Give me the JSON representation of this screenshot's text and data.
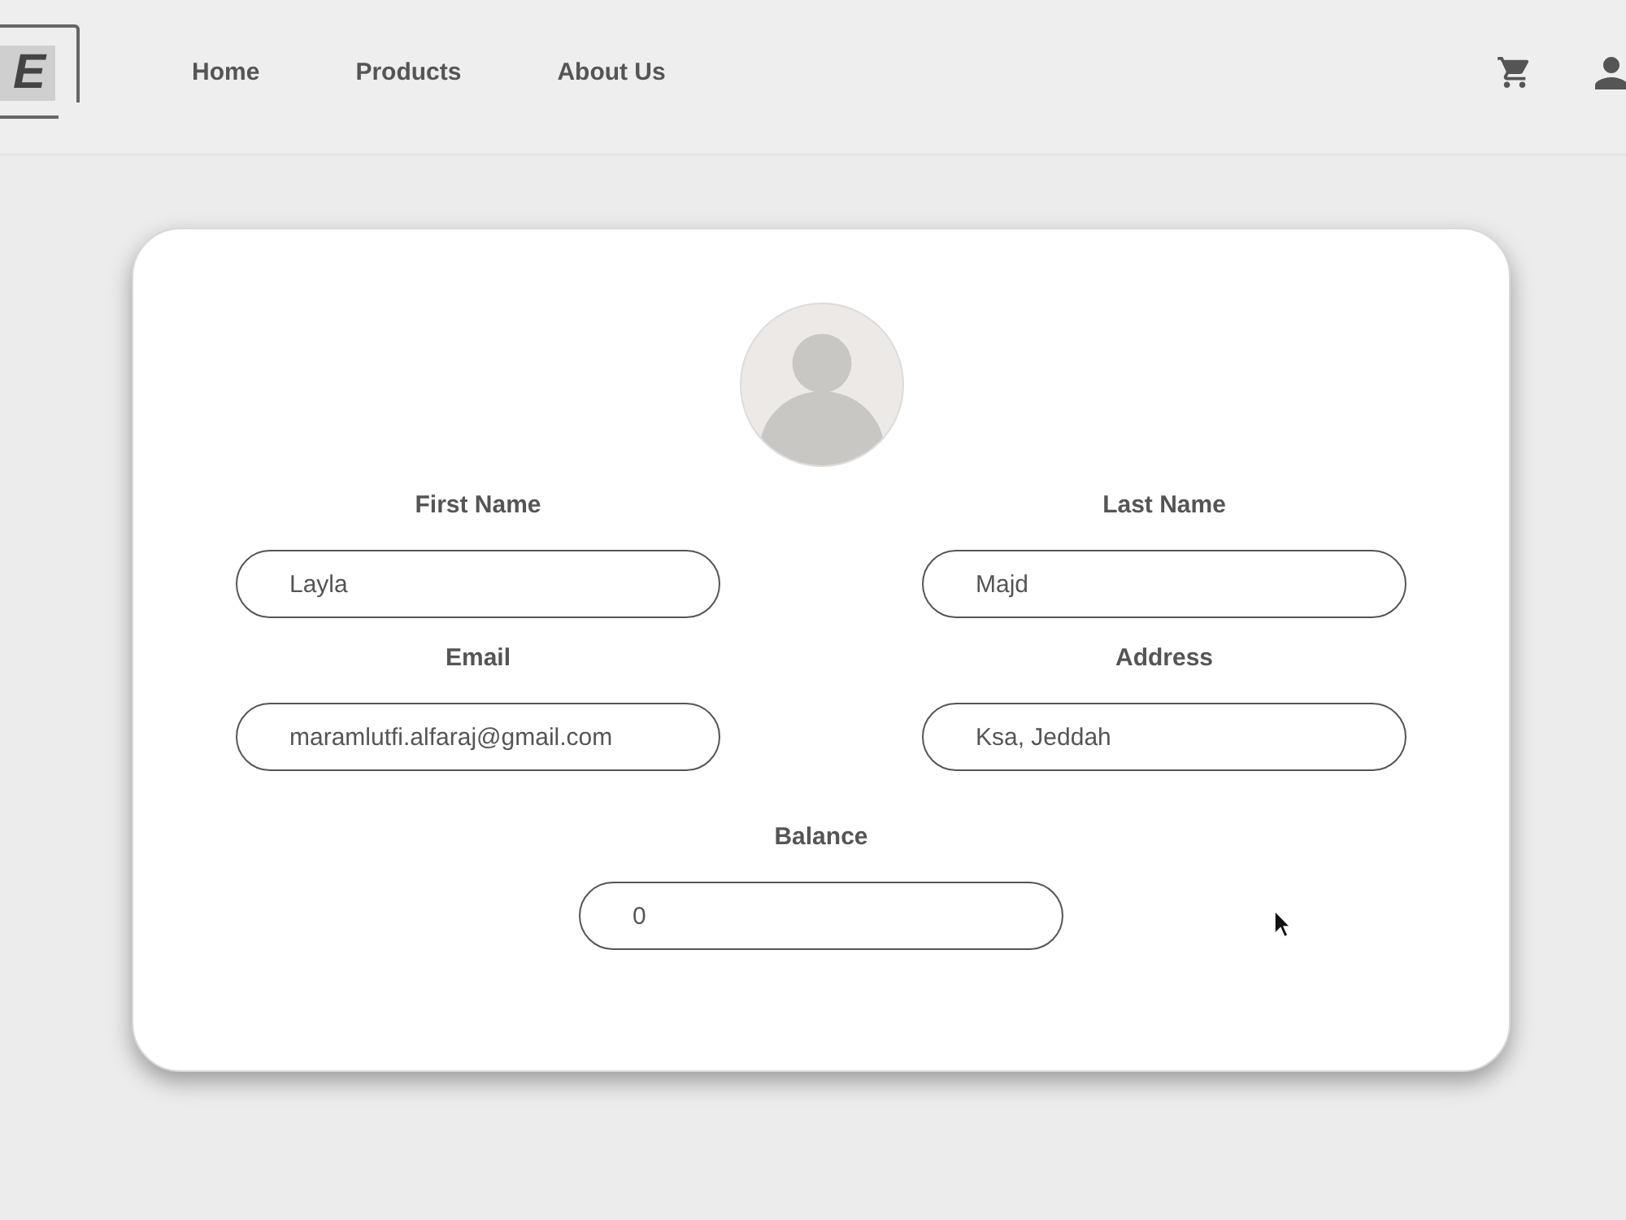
{
  "header": {
    "logo": {
      "text": "E"
    },
    "nav": [
      {
        "label": "Home"
      },
      {
        "label": "Products"
      },
      {
        "label": "About Us"
      }
    ]
  },
  "profile": {
    "fields": [
      {
        "label": "First Name",
        "value": "Layla"
      },
      {
        "label": "Last Name",
        "value": "Majd"
      },
      {
        "label": "Email",
        "value": "maramlutfi.alfaraj@gmail.com"
      },
      {
        "label": "Address",
        "value": "Ksa, Jeddah"
      },
      {
        "label": "Balance",
        "value": "0"
      }
    ]
  }
}
